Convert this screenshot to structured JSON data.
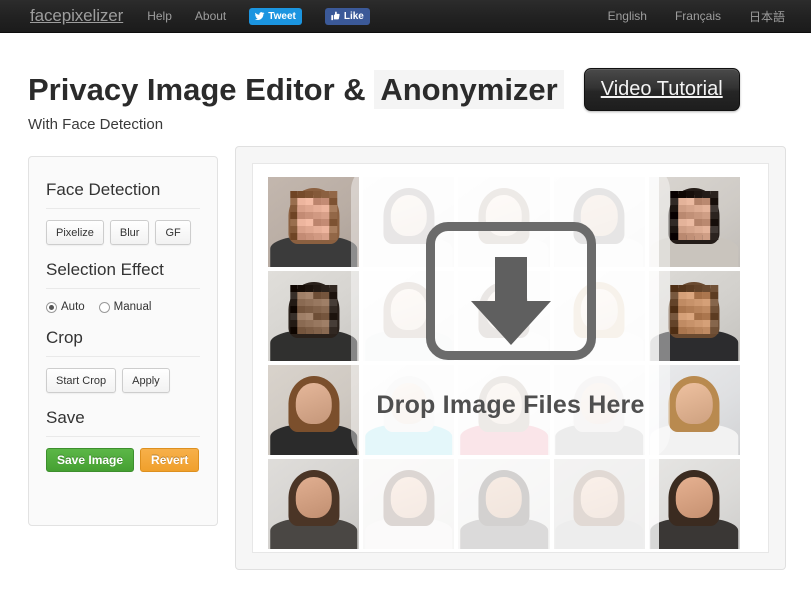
{
  "navbar": {
    "brand": "facepixelizer",
    "links": [
      {
        "label": "Help",
        "name": "nav-help"
      },
      {
        "label": "About",
        "name": "nav-about"
      }
    ],
    "social": [
      {
        "label": "Tweet",
        "icon": "twitter-bird-icon",
        "color": "#1b95e0"
      },
      {
        "label": "Like",
        "icon": "facebook-thumb-icon",
        "color": "#3b5998"
      }
    ],
    "languages": [
      {
        "label": "English"
      },
      {
        "label": "Français"
      },
      {
        "label": "日本語"
      }
    ]
  },
  "header": {
    "title_part1": "Privacy Image Editor &",
    "title_part2": "Anonymizer",
    "video_button": "Video Tutorial",
    "subtitle": "With Face Detection"
  },
  "sidebar": {
    "face_detection": {
      "title": "Face Detection",
      "buttons": [
        {
          "label": "Pixelize"
        },
        {
          "label": "Blur"
        },
        {
          "label": "GF"
        }
      ]
    },
    "selection_effect": {
      "title": "Selection Effect",
      "options": [
        {
          "label": "Auto",
          "selected": true
        },
        {
          "label": "Manual",
          "selected": false
        }
      ]
    },
    "crop": {
      "title": "Crop",
      "buttons": [
        {
          "label": "Start Crop"
        },
        {
          "label": "Apply"
        }
      ]
    },
    "save": {
      "title": "Save",
      "save_label": "Save Image",
      "revert_label": "Revert",
      "save_color": "#4ba03a",
      "revert_color": "#f0a02c"
    }
  },
  "dropzone": {
    "text": "Drop Image Files Here",
    "icon": "download-arrow-icon",
    "grid": {
      "columns": 5,
      "rows": 4,
      "cells": [
        {
          "id": "r1c1",
          "pixelized": true,
          "washed": false,
          "bg": "#b9ada4",
          "skin": "#d8a089",
          "hair": "#8b6040",
          "body": "#3b3b3b"
        },
        {
          "id": "r1c2",
          "pixelized": false,
          "washed": true,
          "bg": "#e9e9e9",
          "skin": "#e0c3ae",
          "hair": "#3a3028",
          "body": "#f0f0f0"
        },
        {
          "id": "r1c3",
          "pixelized": false,
          "washed": true,
          "bg": "#eaeaea",
          "skin": "#e4c7b2",
          "hair": "#6b4a33",
          "body": "#ededed"
        },
        {
          "id": "r1c4",
          "pixelized": false,
          "washed": true,
          "bg": "#e8e8e8",
          "skin": "#c79b79",
          "hair": "#2e2620",
          "body": "#e9e9e9"
        },
        {
          "id": "r1c5",
          "pixelized": true,
          "washed": false,
          "bg": "#cfcbc6",
          "skin": "#cf9e85",
          "hair": "#241c18",
          "body": "#c9c4bd"
        },
        {
          "id": "r2c1",
          "pixelized": true,
          "washed": false,
          "bg": "#d6d4d0",
          "skin": "#8a6a52",
          "hair": "#2a211b",
          "body": "#30302f"
        },
        {
          "id": "r2c2",
          "pixelized": false,
          "washed": true,
          "bg": "#ececec",
          "skin": "#e3c6b0",
          "hair": "#6d4c36",
          "body": "#d8dde0"
        },
        {
          "id": "r2c3",
          "pixelized": false,
          "washed": true,
          "bg": "#ececec",
          "skin": "#e6cab5",
          "hair": "#4a3526",
          "body": "#ededed"
        },
        {
          "id": "r2c4",
          "pixelized": false,
          "washed": true,
          "bg": "#ececec",
          "skin": "#e8cdb8",
          "hair": "#b99257",
          "body": "#ededed"
        },
        {
          "id": "r2c5",
          "pixelized": true,
          "washed": false,
          "bg": "#d2d0cc",
          "skin": "#c08b63",
          "hair": "#6a4a30",
          "body": "#2c2c2e"
        },
        {
          "id": "r3c1",
          "pixelized": false,
          "washed": false,
          "bg": "#cfc9c2",
          "skin": "#d7a98c",
          "hair": "#7b4f2c",
          "body": "#2b2b2b"
        },
        {
          "id": "r3c2",
          "pixelized": false,
          "washed": true,
          "bg": "#ebebeb",
          "skin": "#dcbca4",
          "hair": "#cfcfcf",
          "body": "#17b8cf"
        },
        {
          "id": "r3c3",
          "pixelized": false,
          "washed": true,
          "bg": "#ebebeb",
          "skin": "#d9b79b",
          "hair": "#6a4a33",
          "body": "#d62447"
        },
        {
          "id": "r3c4",
          "pixelized": false,
          "washed": true,
          "bg": "#e6e6e6",
          "skin": "#d2b39b",
          "hair": "#b9b5b0",
          "body": "#5e5d5b"
        },
        {
          "id": "r3c5",
          "pixelized": false,
          "washed": false,
          "bg": "#dfe0e2",
          "skin": "#e0b392",
          "hair": "#b98a4f",
          "body": "#f2f2f2"
        },
        {
          "id": "r4c1",
          "pixelized": false,
          "washed": false,
          "bg": "#d5d3d0",
          "skin": "#d3a183",
          "hair": "#4b3526",
          "body": "#4a4744"
        },
        {
          "id": "r4c2",
          "pixelized": false,
          "washed": false,
          "bg": "#dedcd9",
          "skin": "#dba988",
          "hair": "#4f3526",
          "body": "#e9e7e3"
        },
        {
          "id": "r4c3",
          "pixelized": false,
          "washed": false,
          "bg": "#d9d8d6",
          "skin": "#c9906a",
          "hair": "#241a14",
          "body": "#4a4846"
        },
        {
          "id": "r4c4",
          "pixelized": false,
          "washed": false,
          "bg": "#b9b7b5",
          "skin": "#d6a585",
          "hair": "#6a4428",
          "body": "#a7a5a3"
        },
        {
          "id": "r4c5",
          "pixelized": false,
          "washed": false,
          "bg": "#dcdbd9",
          "skin": "#d8a383",
          "hair": "#3b2b20",
          "body": "#3a3735"
        }
      ]
    }
  }
}
